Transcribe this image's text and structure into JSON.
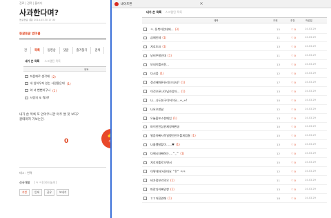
{
  "left": {
    "breadcrumb": "진료 | 권목 | 블라디",
    "title": "사과한다며?",
    "meta": "동글동글 (통) 2014.03.30 17:30",
    "blog_label": "동글동글 범미클",
    "tabs": [
      "전",
      "목록",
      "동영상",
      "댓글",
      "즐겨찾기",
      "검색"
    ],
    "sub": {
      "main": "내가 쓴 목록",
      "extra": "스크랩된 목록"
    },
    "table_header": "제목",
    "rows": [
      {
        "title": "좌음에로 생각해",
        "count": "(2)"
      },
      {
        "title": "내 입하우자 있는 사람좋은데",
        "count": "(1)"
      },
      {
        "title": "야 너 뻔뻔하구나",
        "count": "(1)"
      },
      {
        "title": "사랑의 또 뭐야?",
        "count": ""
      }
    ],
    "note_line1": "내가 쓴 목록 또 안아주니깐 아주 쌀 핫 보자?",
    "note_line2": "갈테마저 가보는건.",
    "like_count": "0",
    "like_label": "추천",
    "tag_line": "태그 : 번역",
    "trackback_label": "신규개발",
    "trackback_tags": "[ㅋ ㅋ] [카드놀이]",
    "bottom_buttons": [
      "추천",
      "인쇄",
      "공유",
      "보내기"
    ]
  },
  "popup": {
    "title": "네이트판",
    "close": "×",
    "sub": {
      "main": "내가 쓴 목록",
      "extra": "스크랩된 목록"
    },
    "headers": {
      "title": "제목",
      "views": "조회",
      "recommend": "추천",
      "date": "작성일"
    },
    "rows": [
      {
        "title": "ㅋ..뒷북이런데에...",
        "count": "(3)",
        "views": "15",
        "rec": "0",
        "date": "14.03.29"
      },
      {
        "title": "금매인데",
        "count": "(1)",
        "views": "11",
        "rec": "0",
        "date": "14.03.29"
      },
      {
        "title": "지호도요",
        "count": "(1)",
        "views": "13",
        "rec": "0",
        "date": "14.03.29"
      },
      {
        "title": "낭비주말인데",
        "count": "(1)",
        "views": "11",
        "rec": "0",
        "date": "14.03.29"
      },
      {
        "title": "보내이를비전...",
        "count": "",
        "views": "13",
        "rec": "0",
        "date": "14.03.29"
      },
      {
        "title": "다시음",
        "count": "(1)",
        "views": "12",
        "rec": "0",
        "date": "14.03.29"
      },
      {
        "title": "정선배마른유리(크나네?",
        "count": "(1)",
        "views": "17",
        "rec": "0",
        "date": "14.03.29"
      },
      {
        "title": "이건오픈나이님카앙자...",
        "count": "(1)",
        "views": "13",
        "rec": "0",
        "date": "14.03.29"
      },
      {
        "title": "나...나도친구이어이요...+_+!",
        "count": "",
        "views": "10",
        "rec": "0",
        "date": "14.03.29"
      },
      {
        "title": "나요오판날",
        "count": "",
        "views": "12",
        "rec": "0",
        "date": "14.03.29"
      },
      {
        "title": "오늘출포소한메입",
        "count": "(1)",
        "views": "13",
        "rec": "0",
        "date": "14.03.29"
      },
      {
        "title": "파이만진심판제경해관궁",
        "count": "",
        "views": "10",
        "rec": "0",
        "date": "14.03.29"
      },
      {
        "title": "벌음아빠사목일했던안이를게법결",
        "count": "(1)",
        "views": "15",
        "rec": "0",
        "date": "14.03.29"
      },
      {
        "title": "나울했잘할이......♥",
        "count": "(1)",
        "views": "13",
        "rec": "0",
        "date": "14.03.29"
      },
      {
        "title": "다해시자빼하는....^_^",
        "count": "(1)",
        "views": "12",
        "rec": "0",
        "date": "14.03.29"
      },
      {
        "title": "지호카톨로오면서",
        "count": "",
        "views": "15",
        "rec": "0",
        "date": "14.03.29"
      },
      {
        "title": "이렇게저어준머요 ^0^ ㅋㅋ",
        "count": "",
        "views": "12",
        "rec": "0",
        "date": "14.03.29"
      },
      {
        "title": "비가정보리의오",
        "count": "(1)",
        "views": "11",
        "rec": "0",
        "date": "14.03.29"
      },
      {
        "title": "파란다이빠인항",
        "count": "(1)",
        "views": "13",
        "rec": "0",
        "date": "14.03.29"
      },
      {
        "title": "ㅎㅎ저진연애",
        "count": "(1)",
        "views": "18",
        "rec": "0",
        "date": "14.03.29"
      }
    ]
  },
  "colors": {
    "accent": "#e0431d",
    "popup_border": "#3a6fd8",
    "like_button": "#e8482a"
  }
}
